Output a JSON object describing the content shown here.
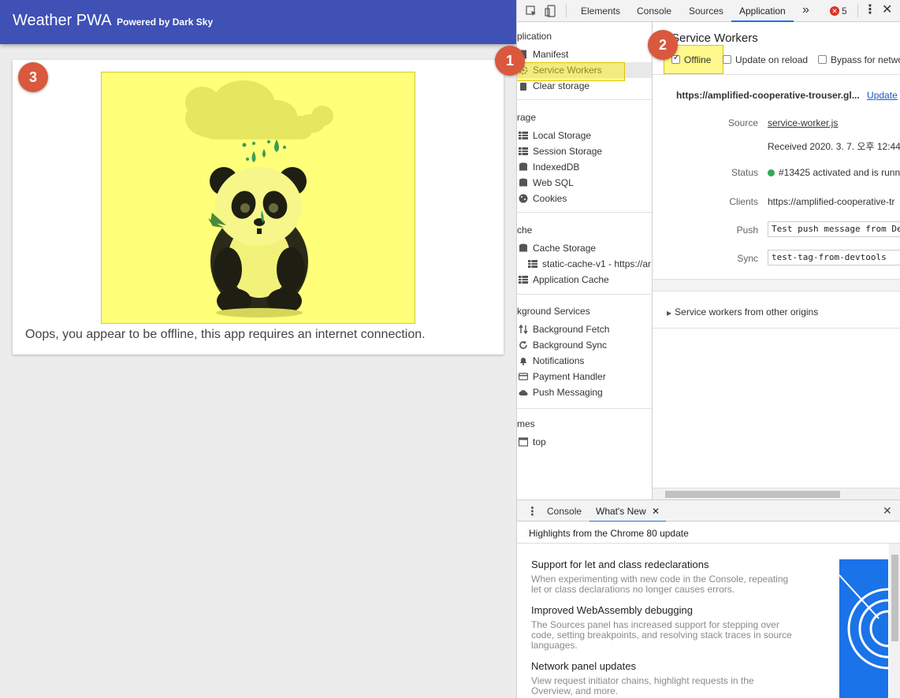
{
  "app": {
    "title": "Weather PWA",
    "subtitle": "Powered by Dark Sky",
    "offline_message": "Oops, you appear to be offline, this app requires an internet connection."
  },
  "annotations": {
    "badge1": "1",
    "badge2": "2",
    "badge3": "3"
  },
  "devtools": {
    "tabs": [
      "Elements",
      "Console",
      "Sources",
      "Application"
    ],
    "active_tab": "Application",
    "more_tabs": "»",
    "error_count": "5",
    "sidebar": {
      "application_header": "plication",
      "manifest": "Manifest",
      "service_workers": "Service Workers",
      "clear_storage": "Clear storage",
      "storage_header": "rage",
      "local_storage": "Local Storage",
      "session_storage": "Session Storage",
      "indexeddb": "IndexedDB",
      "web_sql": "Web SQL",
      "cookies": "Cookies",
      "cache_header": "che",
      "cache_storage": "Cache Storage",
      "static_cache": "static-cache-v1 - https://ar",
      "application_cache": "Application Cache",
      "bg_header": "kground Services",
      "background_fetch": "Background Fetch",
      "background_sync": "Background Sync",
      "notifications": "Notifications",
      "payment_handler": "Payment Handler",
      "push_messaging": "Push Messaging",
      "frames_header": "mes",
      "top": "top"
    },
    "service_workers": {
      "title": "Service Workers",
      "offline": "Offline",
      "update_on_reload": "Update on reload",
      "bypass": "Bypass for netwo",
      "origin": "https://amplified-cooperative-trouser.gl...",
      "update_link": "Update",
      "source_label": "Source",
      "source_link": "service-worker.js",
      "received": "Received 2020. 3. 7. 오후 12:44:4",
      "status_label": "Status",
      "status_value": "#13425 activated and is runn",
      "clients_label": "Clients",
      "clients_value": "https://amplified-cooperative-tr",
      "push_label": "Push",
      "push_value": "Test push message from De",
      "sync_label": "Sync",
      "sync_value": "test-tag-from-devtools",
      "other_origins": "Service workers from other origins"
    },
    "drawer": {
      "console_tab": "Console",
      "whats_new_tab": "What's New",
      "highlights": "Highlights from the Chrome 80 update",
      "items": [
        {
          "title": "Support for let and class redeclarations",
          "desc": "When experimenting with new code in the Console, repeating let or class declarations no longer causes errors."
        },
        {
          "title": "Improved WebAssembly debugging",
          "desc": "The Sources panel has increased support for stepping over code, setting breakpoints, and resolving stack traces in source languages."
        },
        {
          "title": "Network panel updates",
          "desc": "View request initiator chains, highlight requests in the Overview, and more."
        }
      ]
    }
  },
  "colors": {
    "header": "#3f51b5",
    "badge": "#d9583e",
    "highlight": "#ffff7a",
    "link": "#1a56c4",
    "status_green": "#34a853"
  }
}
